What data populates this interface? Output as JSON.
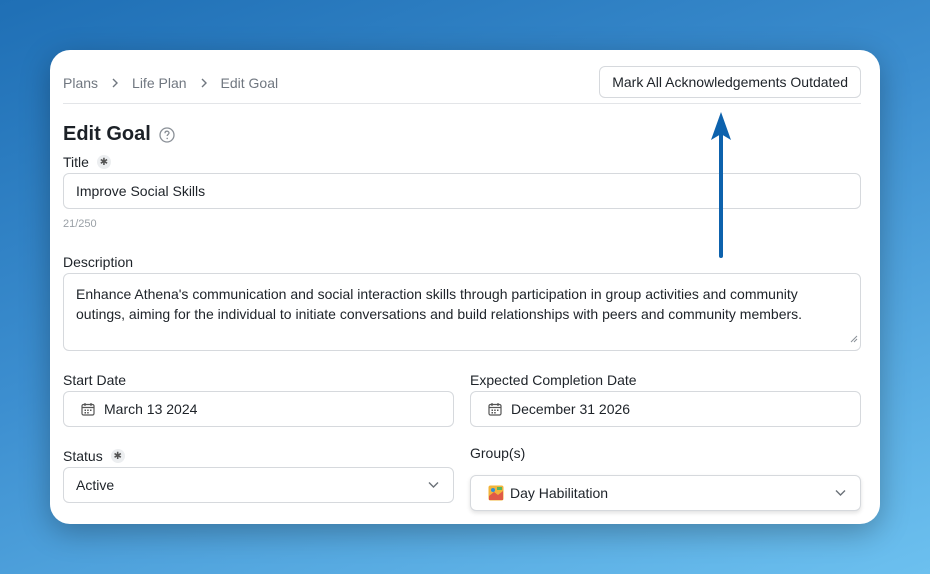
{
  "breadcrumb": {
    "items": [
      "Plans",
      "Life Plan",
      "Edit Goal"
    ]
  },
  "header": {
    "mark_button": "Mark All Acknowledgements Outdated"
  },
  "page": {
    "title": "Edit Goal"
  },
  "form": {
    "title_label": "Title",
    "title_value": "Improve Social Skills",
    "title_counter": "21/250",
    "description_label": "Description",
    "description_value": "Enhance Athena's communication and social interaction skills through participation in group activities and community outings, aiming for the individual to initiate conversations and build relationships with peers and community members.",
    "start_date_label": "Start Date",
    "start_date_value": "March 13 2024",
    "completion_date_label": "Expected Completion Date",
    "completion_date_value": "December 31 2026",
    "status_label": "Status",
    "status_value": "Active",
    "groups_label": "Group(s)",
    "groups_value": "Day Habilitation"
  },
  "colors": {
    "arrow": "#0d62ad",
    "required_badge_bg": "#eceef0"
  }
}
